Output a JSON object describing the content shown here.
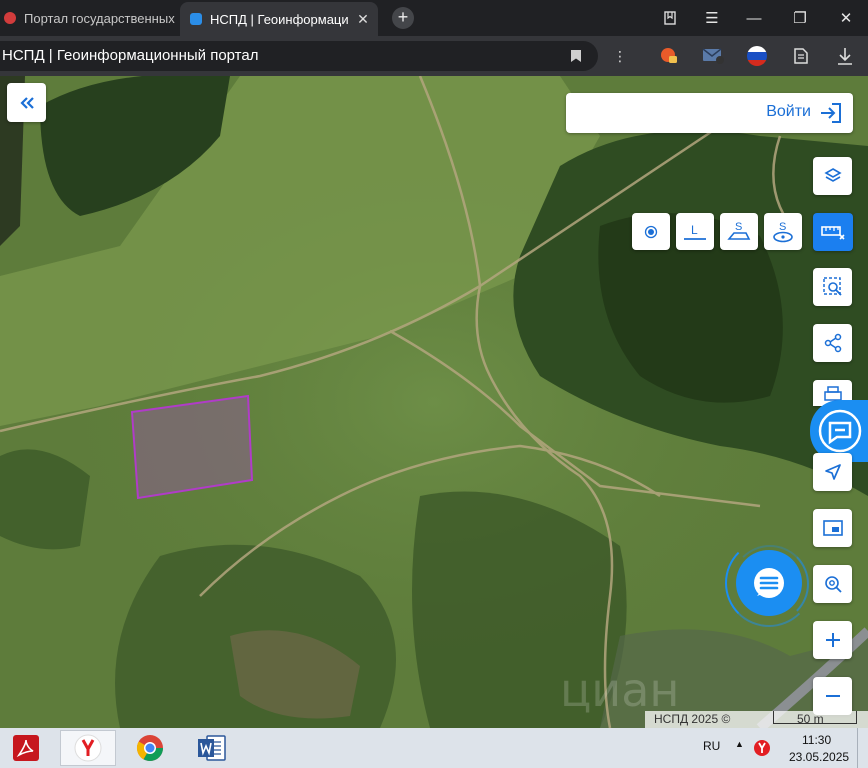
{
  "browser": {
    "tabs": [
      {
        "title": "Портал государственных"
      },
      {
        "title": "НСПД | Геоинформаци",
        "active": true
      }
    ],
    "page_title": "НСПД | Геоинформационный портал"
  },
  "map": {
    "login_label": "Войти",
    "attribution": "НСПД 2025 ©",
    "scale_label": "50 m",
    "measure_tools": [
      {
        "icon": "point-measure-icon",
        "text": ""
      },
      {
        "icon": "length-measure-icon",
        "text": "L"
      },
      {
        "icon": "area-measure-icon",
        "text": "S"
      },
      {
        "icon": "circle-area-measure-icon",
        "text": "S"
      }
    ],
    "colors": {
      "accent": "#1b6fd6",
      "parcel_outline": "#b03cc8",
      "chat": "#1b8ef2"
    }
  },
  "taskbar": {
    "lang": "RU",
    "time": "11:30",
    "date": "23.05.2025"
  }
}
